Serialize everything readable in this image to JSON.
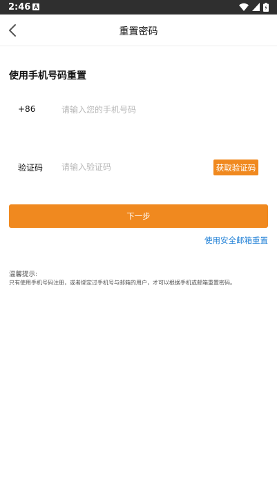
{
  "status_bar": {
    "time": "2:46",
    "icons": [
      "notification-a-icon",
      "wifi-icon",
      "signal-icon",
      "battery-icon"
    ]
  },
  "nav": {
    "back_icon": "chevron-left-icon",
    "title": "重置密码"
  },
  "form": {
    "section_title": "使用手机号码重置",
    "phone_prefix": "+86",
    "phone_placeholder": "请输入您的手机号码",
    "code_label": "验证码",
    "code_placeholder": "请输入验证码",
    "get_code_label": "获取验证码",
    "next_label": "下一步",
    "email_reset_link": "使用安全邮箱重置"
  },
  "tip": {
    "title": "温馨提示:",
    "text": "只有使用手机号码注册，或者绑定过手机号与邮箱的用户，才可以根据手机或邮箱重置密码。"
  },
  "colors": {
    "accent": "#f0891f",
    "link": "#1e7fd6",
    "status_bar": "#2f2f2f"
  }
}
